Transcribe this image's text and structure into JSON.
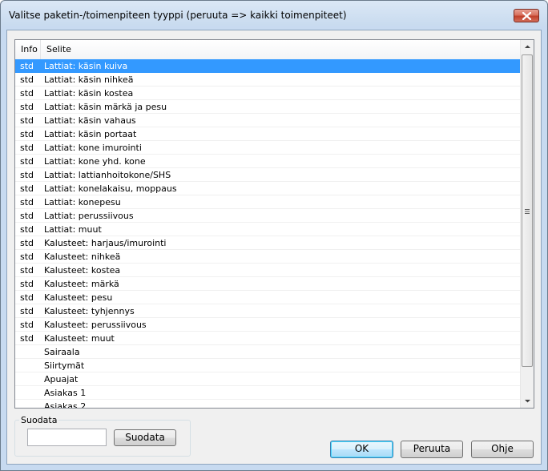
{
  "window": {
    "title": "Valitse paketin-/toimenpiteen tyyppi (peruuta => kaikki toimenpiteet)"
  },
  "list": {
    "columns": [
      "Info",
      "Selite"
    ],
    "rows": [
      {
        "info": "std",
        "selite": "Lattiat: käsin kuiva",
        "selected": true
      },
      {
        "info": "std",
        "selite": "Lattiat: käsin nihkeä"
      },
      {
        "info": "std",
        "selite": "Lattiat: käsin kostea"
      },
      {
        "info": "std",
        "selite": "Lattiat: käsin märkä ja pesu"
      },
      {
        "info": "std",
        "selite": "Lattiat: käsin vahaus"
      },
      {
        "info": "std",
        "selite": "Lattiat: käsin portaat"
      },
      {
        "info": "std",
        "selite": "Lattiat: kone imurointi"
      },
      {
        "info": "std",
        "selite": "Lattiat: kone yhd. kone"
      },
      {
        "info": "std",
        "selite": "Lattiat: lattianhoitokone/SHS"
      },
      {
        "info": "std",
        "selite": "Lattiat: konelakaisu, moppaus"
      },
      {
        "info": "std",
        "selite": "Lattiat: konepesu"
      },
      {
        "info": "std",
        "selite": "Lattiat: perussiivous"
      },
      {
        "info": "std",
        "selite": "Lattiat: muut"
      },
      {
        "info": "std",
        "selite": "Kalusteet: harjaus/imurointi"
      },
      {
        "info": "std",
        "selite": "Kalusteet: nihkeä"
      },
      {
        "info": "std",
        "selite": "Kalusteet: kostea"
      },
      {
        "info": "std",
        "selite": "Kalusteet: märkä"
      },
      {
        "info": "std",
        "selite": "Kalusteet: pesu"
      },
      {
        "info": "std",
        "selite": "Kalusteet: tyhjennys"
      },
      {
        "info": "std",
        "selite": "Kalusteet: perussiivous"
      },
      {
        "info": "std",
        "selite": "Kalusteet: muut"
      },
      {
        "info": "",
        "selite": "Sairaala"
      },
      {
        "info": "",
        "selite": "Siirtymät"
      },
      {
        "info": "",
        "selite": "Apuajat"
      },
      {
        "info": "",
        "selite": "Asiakas 1"
      },
      {
        "info": "",
        "selite": "Asiakas 2"
      }
    ]
  },
  "filter": {
    "group_label": "Suodata",
    "input_value": "",
    "button_label": "Suodata"
  },
  "buttons": {
    "ok": "OK",
    "cancel": "Peruuta",
    "help": "Ohje"
  },
  "colors": {
    "selection": "#3399ff",
    "close_button": "#c1412b"
  },
  "icons": [
    "close-icon",
    "scroll-up-arrow-icon",
    "scroll-down-arrow-icon",
    "scroll-grip-icon"
  ]
}
